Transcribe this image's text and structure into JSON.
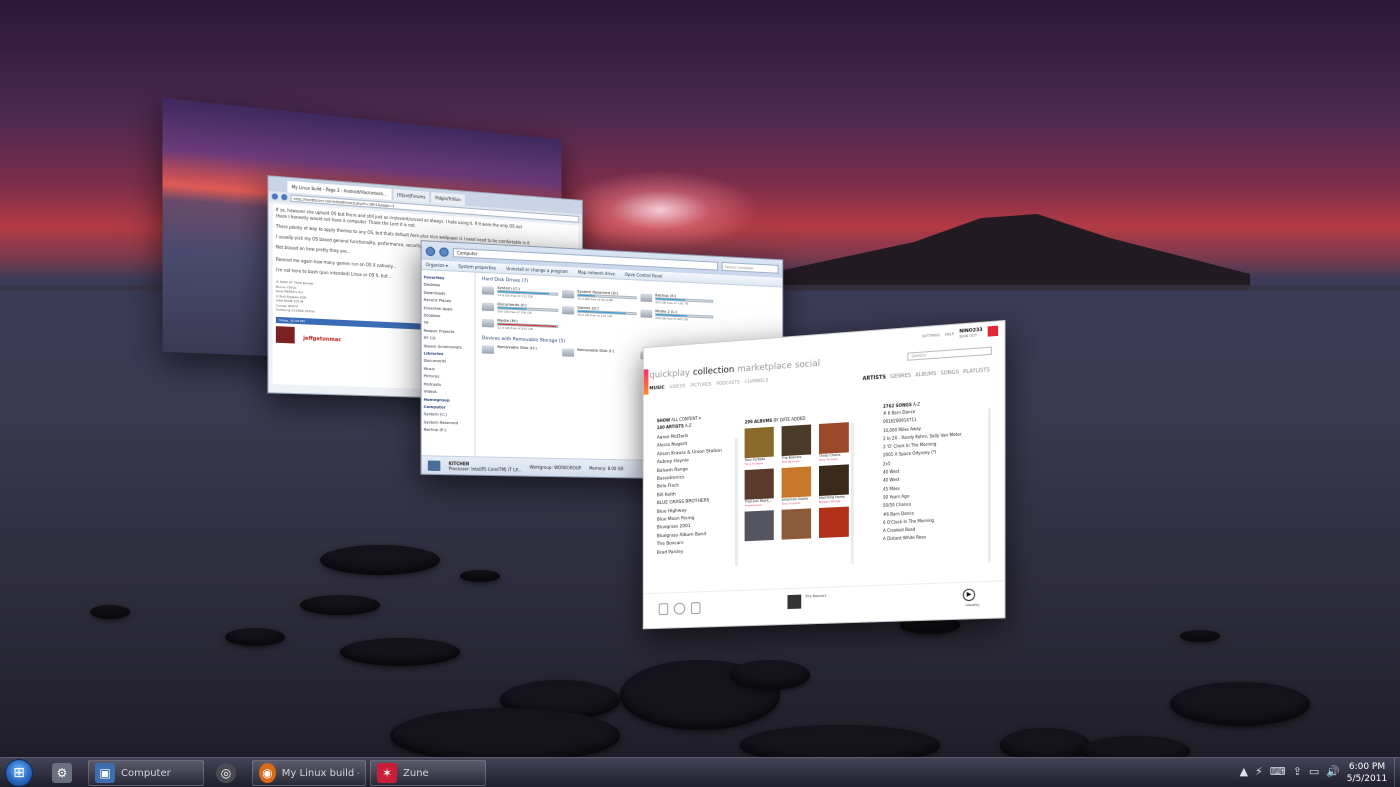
{
  "browser": {
    "tabs": [
      "My Linux build - Page 3 - Android/Hackintosh…",
      "[H]ard|Forums",
      "Pidgin/Trillian"
    ],
    "url": "http://hardforum.com/showthread.php?t=1601&page=3",
    "lines": [
      "If so, however she upheld OS but there and still just as irrelevant/uncool as always. I hate using it. If it were the only OS out",
      "there I honestly would not have a computer. Thank the Lord it is not.",
      "There plenty of way to apply themes to any OS, but thats default Aero plus nice wallpaper is I need need to be comfortable in it",
      "I usually pick my OS based general functionality, performance, security and compatibility.",
      "Not biased on how pretty they are...",
      "Remind me again how many games run on OS X natively...",
      "I'm not here to bash (pun intended) Linux or OS X, but ..."
    ],
    "signature": [
      "i5 4200 XT 750ti Rocket",
      "Bonus 7970x",
      "Asus P8Z68-V Pro",
      "G.Skill Ripjaws 8GB",
      "Intel 80GB X25-M",
      "Corsair 850TX",
      "Samsung 2233RZ 120Hz"
    ],
    "post_bar": "Today, 10:06 PM",
    "username": "jeffgetonmac"
  },
  "explorer": {
    "address": "Computer",
    "search_placeholder": "Search Computer",
    "commands": [
      "Organize ▾",
      "System properties",
      "Uninstall or change a program",
      "Map network drive",
      "Open Control Panel"
    ],
    "nav": [
      {
        "label": "Favorites",
        "head": true
      },
      {
        "label": "Desktop"
      },
      {
        "label": "Downloads"
      },
      {
        "label": "Recent Places"
      },
      {
        "label": "Essential Apps"
      },
      {
        "label": "Dropbox"
      },
      {
        "label": "TA"
      },
      {
        "label": "Reaper Projects"
      },
      {
        "label": "RT CD"
      },
      {
        "label": "Steam Screenshots"
      },
      {
        "label": ""
      },
      {
        "label": "Libraries",
        "head": true
      },
      {
        "label": "Documents"
      },
      {
        "label": "Music"
      },
      {
        "label": "Pictures"
      },
      {
        "label": "Podcasts"
      },
      {
        "label": "Videos"
      },
      {
        "label": ""
      },
      {
        "label": "Homegroup",
        "head": true
      },
      {
        "label": ""
      },
      {
        "label": "Computer",
        "head": true
      },
      {
        "label": "System (C:)"
      },
      {
        "label": "System Reserved"
      },
      {
        "label": "Backup (E:)"
      }
    ],
    "hdd_header": "Hard Disk Drives (7)",
    "drives": [
      {
        "name": "System (C:)",
        "free": "14.8 GB free of 111 GB",
        "fill": 0.87,
        "red": false
      },
      {
        "name": "System Reserved (D:)",
        "free": "70.0 MB free of 99.9 MB",
        "fill": 0.3,
        "red": false
      },
      {
        "name": "Backup (E:)",
        "free": "903 GB free of 1.81 TB",
        "fill": 0.51,
        "red": false
      },
      {
        "name": "Documents (F:)",
        "free": "100 GB free of 196 GB",
        "fill": 0.49,
        "red": false
      },
      {
        "name": "Games (G:)",
        "free": "39.6 GB free of 233 GB",
        "fill": 0.83,
        "red": false
      },
      {
        "name": "Media 2 (L:)",
        "free": "208 GB free of 465 GB",
        "fill": 0.55,
        "red": false
      },
      {
        "name": "Media (M:)",
        "free": "12.4 GB free of 931 GB",
        "fill": 0.98,
        "red": true
      }
    ],
    "removable_header": "Devices with Removable Storage (5)",
    "removable": [
      "Removable Disk (H:)",
      "Removable Disk (I:)",
      "Removable Disk (K:)"
    ],
    "status": {
      "computer_name": "KITCHEN",
      "workgroup": "Workgroup: WORKGROUP",
      "memory": "Memory: 8.00 GB",
      "processor": "Processor: Intel(R) Core(TM) i7 CP..."
    }
  },
  "zune": {
    "top_links": [
      "SETTINGS",
      "HELP"
    ],
    "user": "NINO233",
    "user_sub": "SIGN OUT",
    "nav": [
      "quickplay",
      "collection",
      "marketplace",
      "social"
    ],
    "subnav": [
      "MUSIC",
      "VIDEOS",
      "PICTURES",
      "PODCASTS",
      "CHANNELS"
    ],
    "search_placeholder": "SEARCH",
    "view_tabs": [
      "ARTISTS",
      "GENRES",
      "ALBUMS",
      "SONGS",
      "PLAYLISTS"
    ],
    "show_label": "SHOW",
    "show_value": "ALL CONTENT ▾",
    "artists_header": "140 ARTISTS",
    "artists_sort": "A-Z",
    "artists": [
      "Aaron McDaris",
      "Alecia Nugent",
      "Alison Krauss & Union Station",
      "Aubrey Haynie",
      "Balsam Range",
      "Bassotronics",
      "Béla Fleck",
      "Bill Keith",
      "BLUE GRASS BROTHERS",
      "Blue Highway",
      "Blue Moon Rising",
      "Bluegrass 2001",
      "Bluegrass Album Band",
      "The Boxcars",
      "Brad Paisley"
    ],
    "albums_header": "299 ALBUMS",
    "albums_sort": "BY DATE ADDED",
    "albums": [
      {
        "title": "Tony Furtado",
        "artist": "Tony Furtado",
        "color": "#8a6a2a"
      },
      {
        "title": "The Boxcars",
        "artist": "The Boxcars",
        "color": "#4a3a2a"
      },
      {
        "title": "Three Chains",
        "artist": "Tony Furtado",
        "color": "#9a4a2a"
      },
      {
        "title": "That Just Might...",
        "artist": "Steeldrivers",
        "color": "#5a3a2a"
      },
      {
        "title": "American Gypsy",
        "artist": "Tony Furtado",
        "color": "#c8782a"
      },
      {
        "title": "Marching Home",
        "artist": "Balsam Range",
        "color": "#3a2a1a"
      },
      {
        "title": "",
        "artist": "",
        "color": "#555560"
      },
      {
        "title": "",
        "artist": "",
        "color": "#8a5a3a"
      },
      {
        "title": "",
        "artist": "",
        "color": "#b0301a"
      }
    ],
    "songs_header": "2762 SONGS",
    "songs_sort": "A-Z",
    "songs": [
      "# 6 Barn Dance",
      "0616200914711",
      "10,000 Miles Away",
      "2 In 2X - Randy Kohrs, Sally Van Meter",
      "2 'O' Clock In The Morning",
      "2001 A Space Odyssey (*)",
      "2x5",
      "40 West",
      "40 West",
      "45 Miles",
      "50 Years Ago",
      "50/50 Chance",
      "#6 Barn Dance",
      "6 O'Clock In The Morning",
      "A Crooked Road",
      "A Distant White Rose"
    ],
    "now_playing": "The Boxcars",
    "play_label": "SMARTDJ"
  },
  "taskbar": {
    "start_icon": "windows-orb",
    "buttons": [
      {
        "label": "",
        "icon": "network-icon",
        "color": "#6a7080",
        "glyph": "⚙"
      },
      {
        "label": "Computer",
        "icon": "computer-icon",
        "color": "#3d6fb0",
        "glyph": "▣"
      },
      {
        "label": "",
        "icon": "steam-icon",
        "color": "#4a4a55",
        "glyph": "◎"
      },
      {
        "label": "My Linux build - ...",
        "icon": "firefox-icon",
        "color": "#d86a1a",
        "glyph": "◉"
      },
      {
        "label": "Zune",
        "icon": "zune-icon",
        "color": "#c81e3a",
        "glyph": "✶"
      }
    ],
    "tray": [
      "▲",
      "⚡",
      "⌨",
      "⇪",
      "▭",
      "🔊"
    ],
    "time": "6:00 PM",
    "date": "5/5/2011"
  }
}
